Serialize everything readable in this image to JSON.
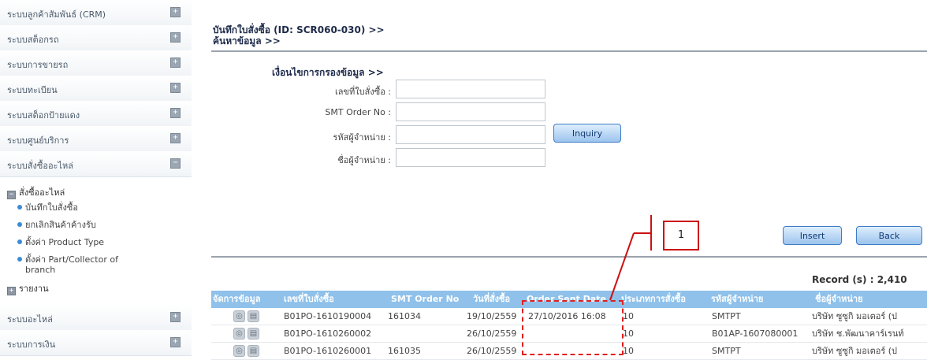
{
  "sidebar": {
    "items": [
      {
        "label": "ระบบลูกค้าสัมพันธ์ (CRM)",
        "toggle": "+"
      },
      {
        "label": "ระบบสต็อกรถ",
        "toggle": "+"
      },
      {
        "label": "ระบบการขายรถ",
        "toggle": "+"
      },
      {
        "label": "ระบบทะเบียน",
        "toggle": "+"
      },
      {
        "label": "ระบบสต็อกป้ายแดง",
        "toggle": "+"
      },
      {
        "label": "ระบบศูนย์บริการ",
        "toggle": "+"
      },
      {
        "label": "ระบบสั่งซื้ออะไหล่",
        "toggle": "−"
      }
    ],
    "subgroup": {
      "label": "สั่งซื้ออะไหล่",
      "toggle": "−"
    },
    "subitems": [
      "บันทึกใบสั่งซื้อ",
      "ยกเลิกสินค้าค้างรับ",
      "ตั้งค่า Product Type",
      "ตั้งค่า Part/Collector of",
      "branch"
    ],
    "report_group": {
      "label": "รายงาน",
      "toggle": "+"
    },
    "bottom_items": [
      {
        "label": "ระบบอะไหล่",
        "toggle": "+"
      },
      {
        "label": "ระบบการเงิน",
        "toggle": "+"
      }
    ]
  },
  "header": {
    "title_line1": "บันทึกใบสั่งซื้อ (ID: SCR060-030) >>",
    "title_line2": "ค้นหาข้อมูล >>"
  },
  "filter": {
    "section_title": "เงื่อนไขการกรองข้อมูล >>",
    "fields": [
      {
        "label": "เลขที่ใบสั่งซื้อ :",
        "value": ""
      },
      {
        "label": "SMT Order No :",
        "value": ""
      },
      {
        "label": "รหัสผู้จำหน่าย :",
        "value": ""
      },
      {
        "label": "ชื่อผู้จำหน่าย :",
        "value": ""
      }
    ],
    "inquiry_label": "Inquiry"
  },
  "actions": {
    "insert_label": "Insert",
    "back_label": "Back"
  },
  "annotation": {
    "number": "1"
  },
  "record_count": "Record (s) : 2,410",
  "table": {
    "headers": [
      "จัดการข้อมูล",
      "เลขที่ใบสั่งซื้อ",
      "SMT Order No",
      "วันที่สั่งซื้อ",
      "Order Sent Date",
      "ประเภทการสั่งซื้อ",
      "รหัสผู้จำหน่าย",
      "ชื่อผู้จำหน่าย"
    ],
    "rows": [
      [
        "",
        "B01PO-1610190004",
        "161034",
        "19/10/2559",
        "27/10/2016 16:08",
        "10",
        "SMTPT",
        "บริษัท ซูซูกิ มอเตอร์ (ป"
      ],
      [
        "",
        "B01PO-1610260002",
        "",
        "26/10/2559",
        "",
        "10",
        "B01AP-1607080001",
        "บริษัท ช.พัฒนาคาร์เรนท์"
      ],
      [
        "",
        "B01PO-1610260001",
        "161035",
        "26/10/2559",
        "",
        "10",
        "SMTPT",
        "บริษัท ซูซูกิ มอเตอร์ (ป"
      ]
    ]
  },
  "colors": {
    "accent": "#8fc1ea",
    "annotation_red": "#cc1111",
    "button": "#9cc4ee"
  }
}
